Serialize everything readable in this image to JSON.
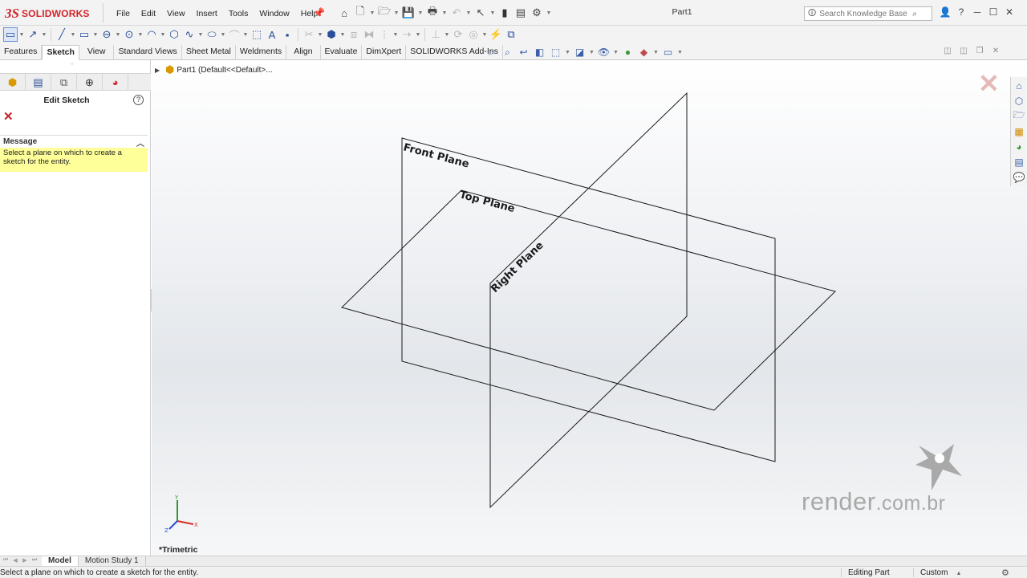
{
  "app": {
    "logo_ds": "3S",
    "logo_text": "SOLIDWORKS",
    "document_title": "Part1"
  },
  "menu": [
    "File",
    "Edit",
    "View",
    "Insert",
    "Tools",
    "Window",
    "Help"
  ],
  "search": {
    "placeholder": "Search Knowledge Base"
  },
  "command_tabs": [
    "Features",
    "Sketch",
    "View",
    "Standard Views",
    "Sheet Metal",
    "Weldments",
    "Align",
    "Evaluate",
    "DimXpert",
    "SOLIDWORKS Add-Ins"
  ],
  "active_command_tab": "Sketch",
  "property_manager": {
    "title": "Edit Sketch",
    "message_header": "Message",
    "message_text": "Select a plane on which to create a sketch for the entity."
  },
  "feature_tree": {
    "root_label": "Part1  (Default<<Default>..."
  },
  "planes": {
    "front": "Front Plane",
    "top": "Top Plane",
    "right": "Right Plane"
  },
  "triad": {
    "y": "Y",
    "z": "Z",
    "x": "X"
  },
  "view_orientation": "*Trimetric",
  "watermark": {
    "name": "render",
    "domain": ".com.br"
  },
  "bottom_tabs": [
    "Model",
    "Motion Study 1"
  ],
  "active_bottom_tab": "Model",
  "status": {
    "message": "Select a plane on which to create a sketch for the entity.",
    "mode": "Editing Part",
    "units": "Custom"
  },
  "colors": {
    "brand_red": "#d2232a",
    "message_bg": "#ffff99",
    "accent_blue": "#2a4f9a"
  }
}
